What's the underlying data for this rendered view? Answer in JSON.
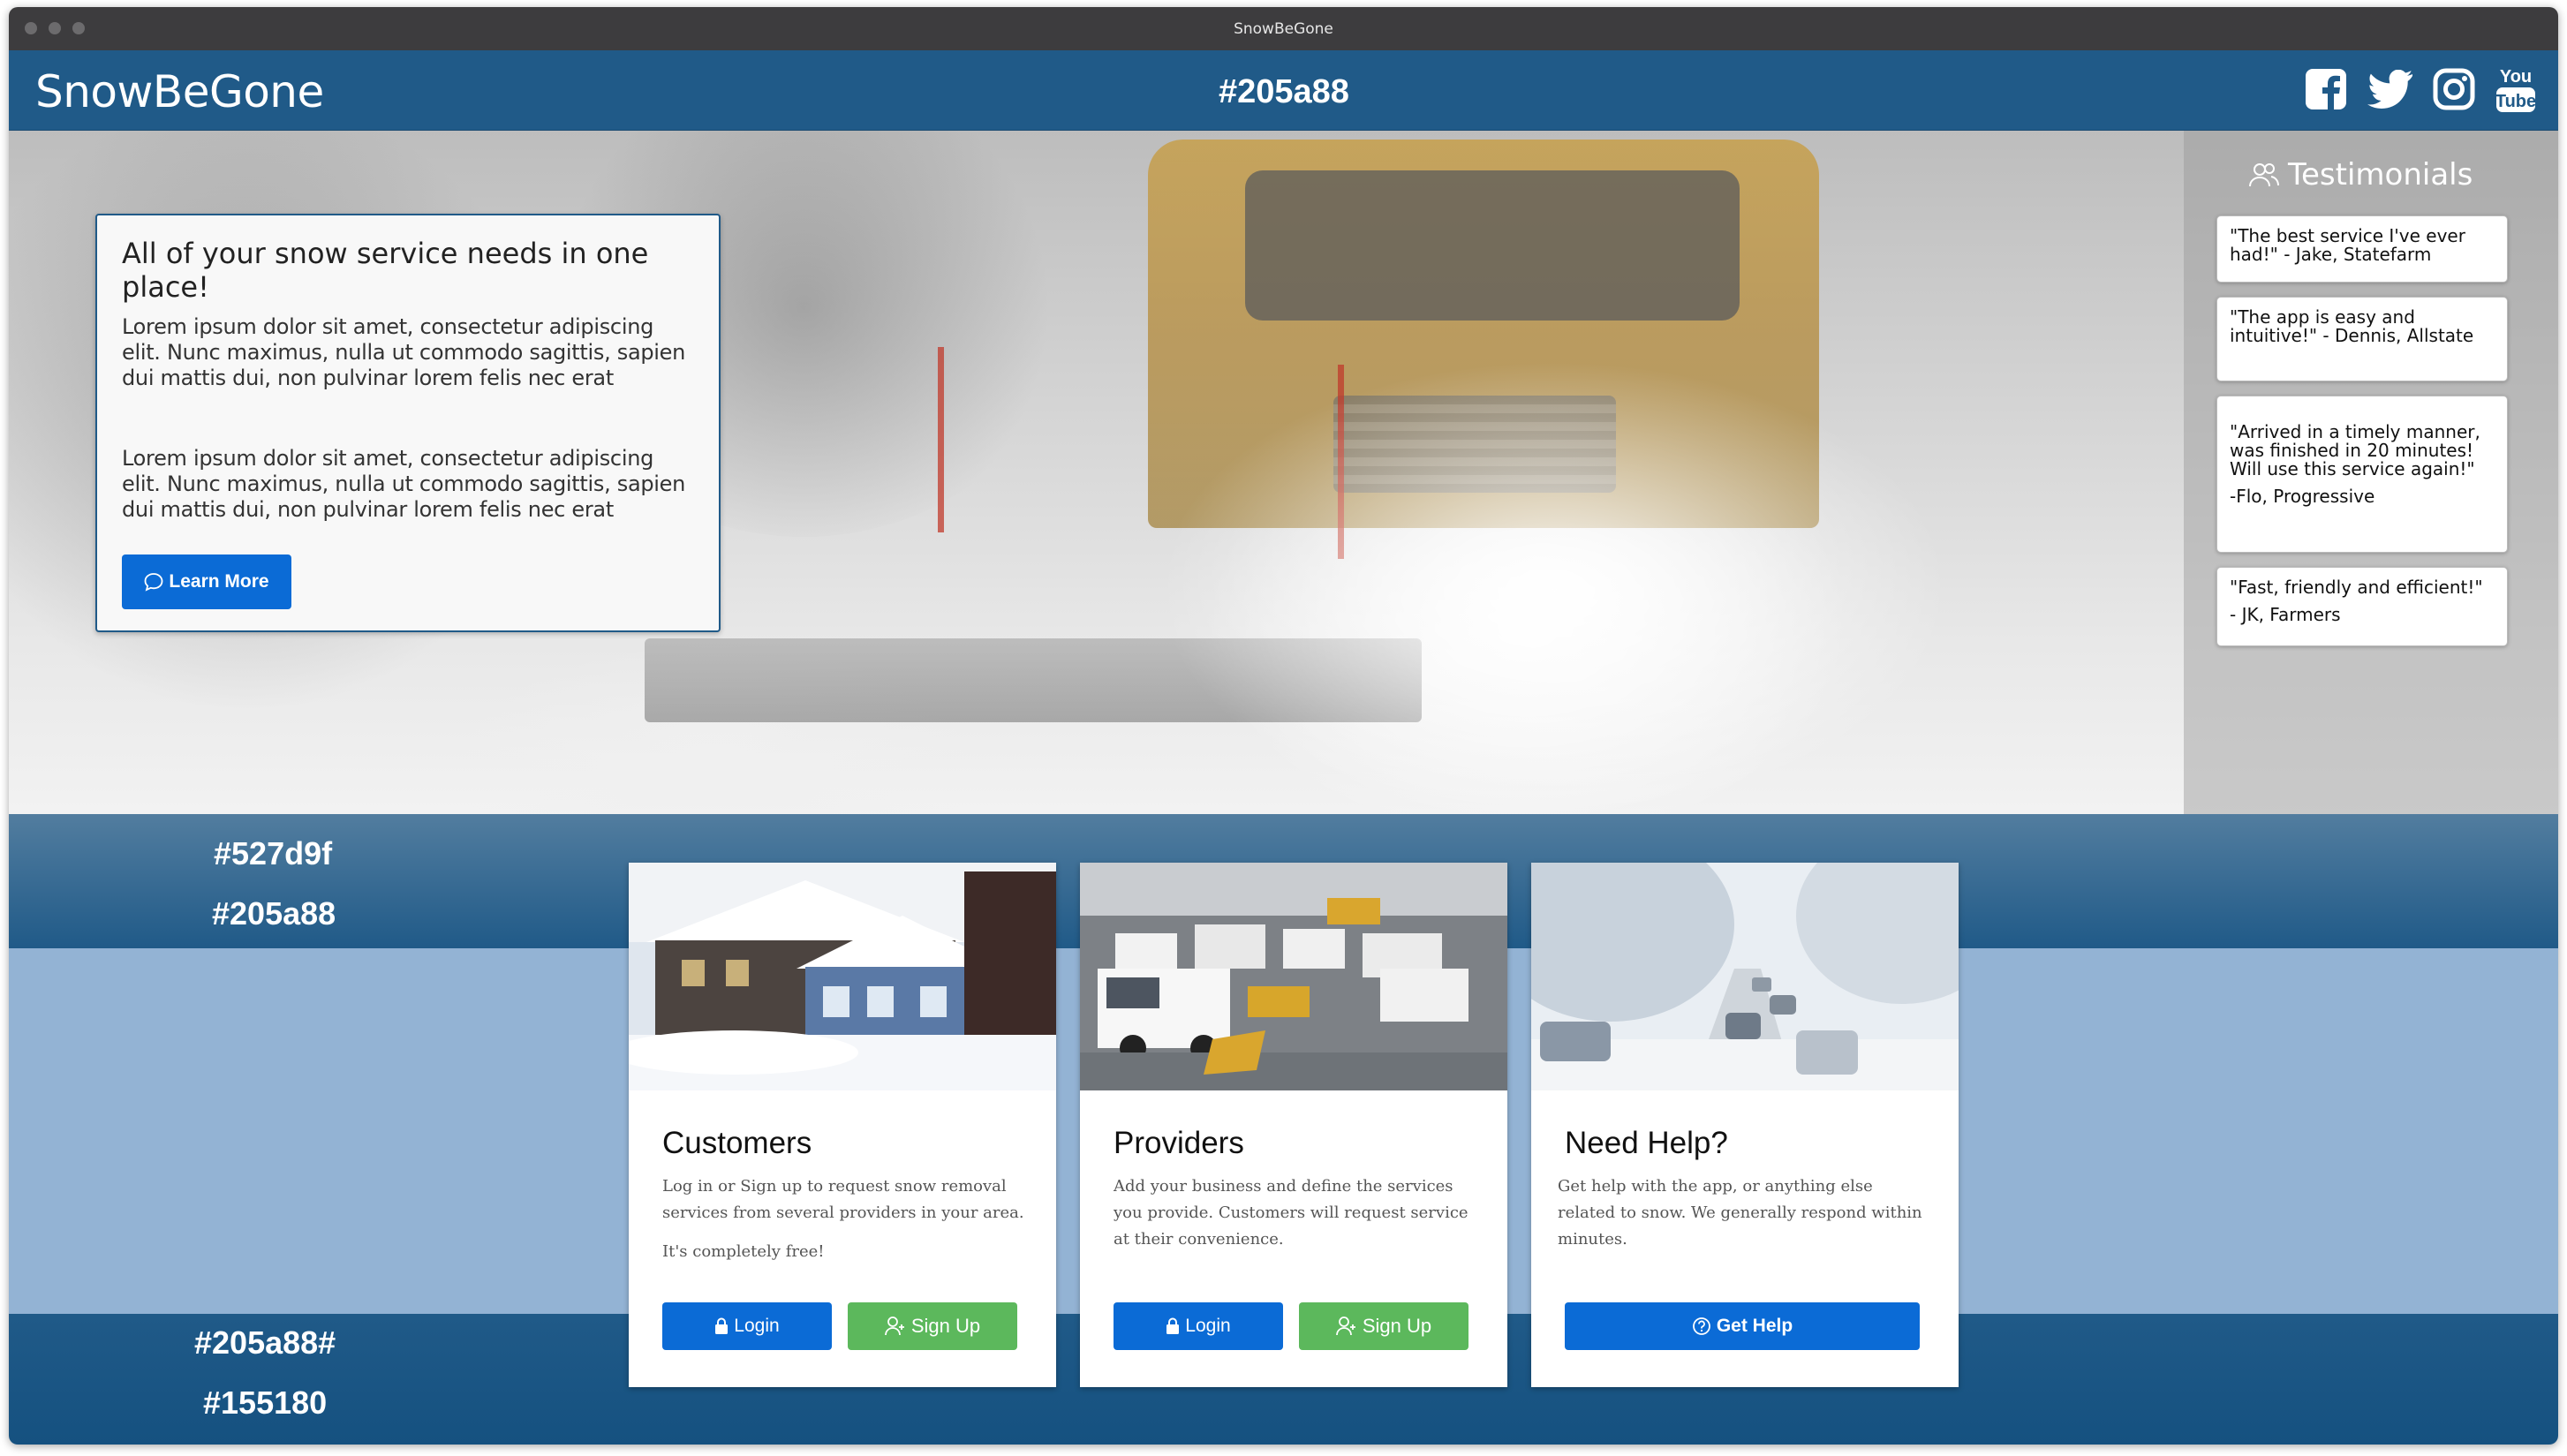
{
  "window": {
    "title": "SnowBeGone"
  },
  "navbar": {
    "brand": "SnowBeGone",
    "color_label": "#205a88",
    "icons": [
      "facebook-icon",
      "twitter-icon",
      "instagram-icon",
      "youtube-icon"
    ],
    "youtube_text_top": "You",
    "youtube_text_bottom": "Tube"
  },
  "hero": {
    "heading": "All of your snow service needs in one place!",
    "paragraph_1": "Lorem ipsum dolor sit amet, consectetur adipiscing elit. Nunc maximus, nulla ut commodo sagittis, sapien dui mattis dui, non pulvinar lorem felis nec erat",
    "paragraph_2": "Lorem ipsum dolor sit amet, consectetur adipiscing elit. Nunc maximus, nulla ut commodo sagittis, sapien dui mattis dui, non pulvinar lorem felis nec erat",
    "learn_more_label": "Learn More"
  },
  "testimonials": {
    "title": "Testimonials",
    "items": [
      {
        "quote": "\"The best service I've ever had!\" - Jake, Statefarm",
        "author": ""
      },
      {
        "quote": "\"The app is easy and intuitive!\" - Dennis, Allstate",
        "author": ""
      },
      {
        "quote": "\"Arrived in a timely manner, was finished in 20 minutes! Will use this service again!\"",
        "author": "-Flo, Progressive"
      },
      {
        "quote": "\"Fast, friendly and efficient!\"",
        "author": "- JK, Farmers"
      }
    ]
  },
  "bands": {
    "top_label_1": "#527d9f",
    "top_label_2": "#205a88",
    "bottom_label_1": "#205a88#",
    "bottom_label_2": "#155180"
  },
  "cards": {
    "customers": {
      "title": "Customers",
      "text": "Log in or Sign up to request snow removal services from several providers in your area.",
      "note": "It's completely free!",
      "login_label": "Login",
      "signup_label": "Sign Up"
    },
    "providers": {
      "title": "Providers",
      "text": "Add your business and define the services you provide.  Customers will request service at their convenience.",
      "login_label": "Login",
      "signup_label": "Sign Up"
    },
    "help": {
      "title": "Need Help?",
      "text": "Get help with the app, or anything else related to snow.  We generally respond within minutes.",
      "help_label": "Get Help"
    }
  },
  "colors": {
    "navbar": "#205a88",
    "band_top_start": "#527d9f",
    "band_top_end": "#205a88",
    "band_bottom_start": "#205a88",
    "band_bottom_end": "#155180",
    "band_middle": "#93b3d4",
    "primary_button": "#0b6bd6",
    "success_button": "#5cb85c"
  }
}
